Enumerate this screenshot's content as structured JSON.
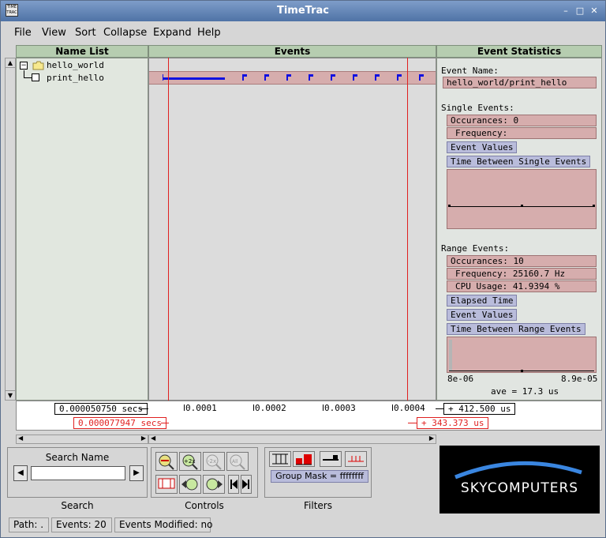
{
  "window": {
    "title": "TimeTrac",
    "minimize": "–",
    "maximize": "□",
    "close": "✕",
    "app_icon_text": "TIME TRAC"
  },
  "menu": [
    "File",
    "View",
    "Sort",
    "Collapse",
    "Expand",
    "Help"
  ],
  "headers": {
    "name_list": "Name List",
    "events": "Events",
    "event_statistics": "Event Statistics"
  },
  "tree": [
    {
      "label": "hello_world",
      "expander": "−"
    },
    {
      "label": "print_hello"
    }
  ],
  "stats": {
    "event_name_label": "Event Name:",
    "event_name_value": "hello_world/print_hello",
    "single_events_label": "Single Events:",
    "single_occurances": "Occurances: 0",
    "single_frequency": "Frequency:",
    "event_values_btn": "Event Values",
    "time_between_single_btn": "Time Between Single Events",
    "range_events_label": "Range Events:",
    "range_occurances": "Occurances: 10",
    "range_frequency": "Frequency: 25160.7 Hz",
    "cpu_usage": "CPU Usage: 41.9394 %",
    "elapsed_time_btn": "Elapsed Time",
    "range_event_values_btn": "Event Values",
    "time_between_range_btn": "Time Between Range Events",
    "hist_min": "8e-06",
    "hist_max": "8.9e-05",
    "hist_ave": "ave = 17.3 us"
  },
  "axis": {
    "left_time": "0.000050750 secs",
    "cursor_time": "0.000077947 secs",
    "right_delta": "+ 412.500 us",
    "cursor_delta": "+ 343.373 us",
    "ticks": [
      "0.0001",
      "0.0002",
      "0.0003",
      "0.0004"
    ]
  },
  "search": {
    "title": "Search Name",
    "value": "",
    "label": "Search",
    "prev": "◀",
    "next": "▶"
  },
  "controls": {
    "label": "Controls"
  },
  "filters": {
    "label": "Filters",
    "group_mask": "Group Mask = ffffffff"
  },
  "logo": {
    "text": "SKYCOMPUTERS"
  },
  "status": {
    "path": "Path: .",
    "events": "Events: 20",
    "modified": "Events Modified: no"
  },
  "colors": {
    "event_bar": "#1010e0",
    "row_bg": "#d6adad",
    "cursor": "#e02020",
    "header_bg": "#b6cdb0"
  }
}
